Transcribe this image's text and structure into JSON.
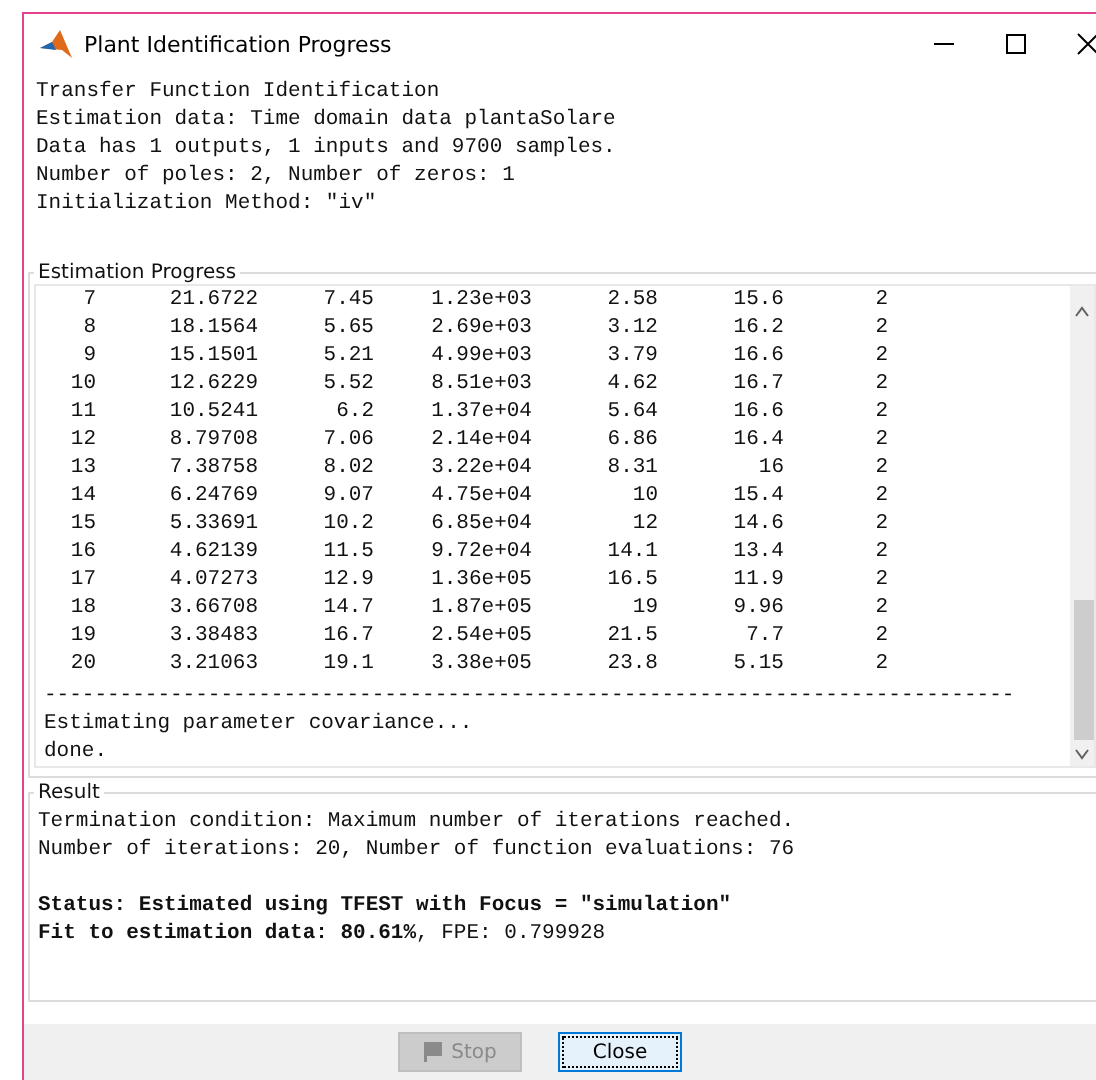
{
  "window": {
    "title": "Plant Identification Progress"
  },
  "header_lines": [
    "Transfer Function Identification",
    "Estimation data: Time domain data plantaSolare",
    "Data has 1 outputs, 1 inputs and 9700 samples.",
    "Number of poles: 2, Number of zeros: 1",
    "Initialization Method: \"iv\""
  ],
  "estimation_progress": {
    "title": "Estimation Progress",
    "rows": [
      {
        "cells": [
          "7",
          "21.6722",
          "7.45",
          "1.23e+03",
          "2.58",
          "15.6",
          "2"
        ]
      },
      {
        "cells": [
          "8",
          "18.1564",
          "5.65",
          "2.69e+03",
          "3.12",
          "16.2",
          "2"
        ]
      },
      {
        "cells": [
          "9",
          "15.1501",
          "5.21",
          "4.99e+03",
          "3.79",
          "16.6",
          "2"
        ]
      },
      {
        "cells": [
          "10",
          "12.6229",
          "5.52",
          "8.51e+03",
          "4.62",
          "16.7",
          "2"
        ]
      },
      {
        "cells": [
          "11",
          "10.5241",
          "6.2",
          "1.37e+04",
          "5.64",
          "16.6",
          "2"
        ]
      },
      {
        "cells": [
          "12",
          "8.79708",
          "7.06",
          "2.14e+04",
          "6.86",
          "16.4",
          "2"
        ]
      },
      {
        "cells": [
          "13",
          "7.38758",
          "8.02",
          "3.22e+04",
          "8.31",
          "16",
          "2"
        ]
      },
      {
        "cells": [
          "14",
          "6.24769",
          "9.07",
          "4.75e+04",
          "10",
          "15.4",
          "2"
        ]
      },
      {
        "cells": [
          "15",
          "5.33691",
          "10.2",
          "6.85e+04",
          "12",
          "14.6",
          "2"
        ]
      },
      {
        "cells": [
          "16",
          "4.62139",
          "11.5",
          "9.72e+04",
          "14.1",
          "13.4",
          "2"
        ]
      },
      {
        "cells": [
          "17",
          "4.07273",
          "12.9",
          "1.36e+05",
          "16.5",
          "11.9",
          "2"
        ]
      },
      {
        "cells": [
          "18",
          "3.66708",
          "14.7",
          "1.87e+05",
          "19",
          "9.96",
          "2"
        ]
      },
      {
        "cells": [
          "19",
          "3.38483",
          "16.7",
          "2.54e+05",
          "21.5",
          "7.7",
          "2"
        ]
      },
      {
        "cells": [
          "20",
          "3.21063",
          "19.1",
          "3.38e+05",
          "23.8",
          "5.15",
          "2"
        ]
      }
    ],
    "separator": "-----------------------------------------------------------------------------",
    "lines": [
      "Estimating parameter covariance...",
      "done."
    ]
  },
  "result": {
    "title": "Result",
    "lines": [
      {
        "text": "Termination condition: Maximum number of iterations reached.",
        "bold": false
      },
      {
        "text": "Number of iterations: 20, Number of function evaluations: 76",
        "bold": false
      },
      {
        "text": "Status: Estimated using TFEST with Focus = \"simulation\"",
        "bold": true
      },
      {
        "text": "**Fit to estimation data: 80.61%**, FPE: 0.799928",
        "bold": false
      }
    ]
  },
  "buttons": [
    {
      "label": "Stop",
      "kind": "stop",
      "disabled": true,
      "focused": false
    },
    {
      "label": "Close",
      "kind": "close",
      "disabled": false,
      "focused": true
    }
  ]
}
